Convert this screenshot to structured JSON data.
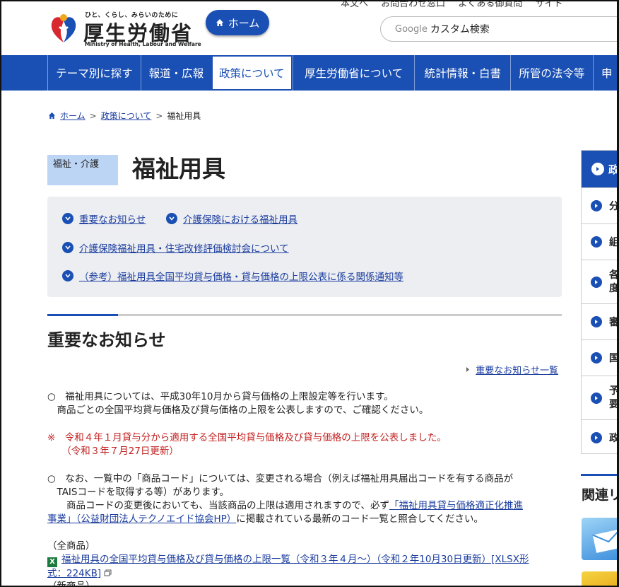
{
  "header": {
    "top_links": [
      "本文へ",
      "お問合わせ窓口",
      "よくある御質問",
      "サイト"
    ],
    "logo_tagline": "ひと、くらし、みらいのために",
    "logo_name": "厚生労働省",
    "logo_en": "Ministry of Health, Labour and Welfare",
    "home_label": "ホーム",
    "search_brand": "Google",
    "search_placeholder": "カスタム検索"
  },
  "nav": {
    "items": [
      {
        "label": "テーマ別に探す"
      },
      {
        "label": "報道・広報"
      },
      {
        "label": "政策について"
      },
      {
        "label": "厚生労働省について"
      },
      {
        "label": "統計情報・白書"
      },
      {
        "label": "所管の法令等"
      },
      {
        "label": "申"
      }
    ],
    "active_index": 2
  },
  "breadcrumb": {
    "home": "ホーム",
    "parent": "政策について",
    "current": "福祉用具",
    "sep": ">"
  },
  "page": {
    "category": "福祉・介護",
    "title": "福祉用具"
  },
  "anchors": [
    {
      "label": "重要なお知らせ"
    },
    {
      "label": "介護保険における福祉用具"
    },
    {
      "label": "介護保険福祉用具・住宅改修評価検討会について"
    },
    {
      "label": "（参考）福祉用具全国平均貸与価格・貸与価格の上限公表に係る関係通知等"
    }
  ],
  "section": {
    "title": "重要なお知らせ",
    "list_link": "重要なお知らせ一覧",
    "p1_line1": "○　福祉用具については、平成30年10月から貸与価格の上限設定等を行います。",
    "p1_line2": "　商品ごとの全国平均貸与価格及び貸与価格の上限を公表しますので、ご確認ください。",
    "notice_line1": "※　令和４年１月貸与分から適用する全国平均貸与価格及び貸与価格の上限を公表しました。",
    "notice_line2": "　　（令和３年７月27日更新）",
    "p2_line1": "○　なお、一覧中の「商品コード」については、変更される場合（例えば福祉用具届出コードを有する商品が",
    "p2_line2": "　TAISコードを取得する等）があります。",
    "p2_line3_prefix": "　　商品コードの変更後においても、当該商品の上限は適用されますので、必ず",
    "p2_link_a": "「福祉用具貸与価格適正化推進",
    "p2_link_b": "事業」（公益財団法人テクノエイド協会HP）",
    "p2_line4_suffix": "に掲載されている最新のコード一覧と照合してください。",
    "all_products_label": "（全商品）",
    "xlsx_link_a": "福祉用具の全国平均貸与価格及び貸与価格の上限一覧（令和３年４月～）（令和２年10月30日更新）[XLSX形",
    "xlsx_link_b": "式：224KB]",
    "new_products_label": "（新商品）"
  },
  "side_panel": {
    "head": "政",
    "items": [
      "分",
      "組",
      "各",
      "度",
      "審",
      "国",
      "予",
      "要",
      "政"
    ]
  },
  "related": {
    "title": "関連リ"
  },
  "colors": {
    "brand_blue": "#1a4fb4",
    "notice_red": "#c31f1f",
    "badge_bg": "#bcd5f5",
    "anchor_bg": "#eceef2"
  }
}
